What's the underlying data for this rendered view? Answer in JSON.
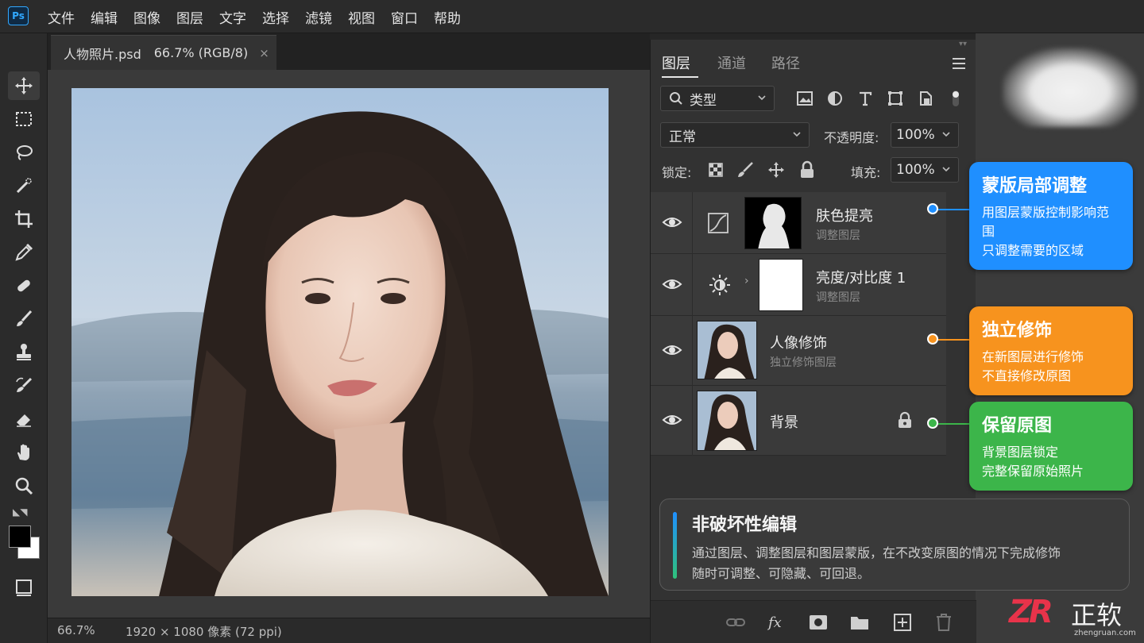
{
  "app": {
    "logo": "Ps"
  },
  "menu": [
    "文件",
    "编辑",
    "图像",
    "图层",
    "文字",
    "选择",
    "滤镜",
    "视图",
    "窗口",
    "帮助"
  ],
  "document": {
    "tab_label": "人物照片.psd",
    "tab_mode": "66.7% (RGB/8)",
    "close": "×"
  },
  "statusbar": {
    "zoom": "66.7%",
    "doc_info": "1920 × 1080 像素 (72 ppi)"
  },
  "tools": [
    "move-tool",
    "marquee-tool",
    "lasso-tool",
    "quick-select-tool",
    "crop-tool",
    "eyedropper-tool",
    "healing-brush-tool",
    "brush-tool",
    "clone-stamp-tool",
    "history-brush-tool",
    "eraser-tool",
    "hand-tool",
    "zoom-tool"
  ],
  "colors": {
    "foreground": "#000000",
    "background": "#ffffff",
    "accent_blue": "#1f8fff",
    "accent_orange": "#f7931e",
    "accent_green": "#3cb54a"
  },
  "layers_panel": {
    "tabs": [
      "图层",
      "通道",
      "路径"
    ],
    "active_tab": "图层",
    "filter": {
      "label": "类型"
    },
    "blend_mode": "正常",
    "opacity": {
      "label": "不透明度:",
      "value": "100%"
    },
    "lock": {
      "label": "锁定:"
    },
    "fill": {
      "label": "填充:",
      "value": "100%"
    },
    "layers": [
      {
        "name": "肤色提亮",
        "sub": "调整图层",
        "kind": "curves-adjustment",
        "visible": true
      },
      {
        "name": "亮度/对比度 1",
        "sub": "调整图层",
        "kind": "brightness-contrast-adjustment",
        "visible": true
      },
      {
        "name": "人像修饰",
        "sub": "独立修饰图层",
        "kind": "pixel-layer",
        "visible": true
      },
      {
        "name": "背景",
        "sub": "",
        "kind": "background-layer",
        "visible": true,
        "locked": true
      }
    ]
  },
  "callouts": [
    {
      "title": "蒙版局部调整",
      "lines": [
        "用图层蒙版控制影响范围",
        "只调整需要的区域"
      ],
      "color": "#1f8fff"
    },
    {
      "title": "独立修饰",
      "lines": [
        "在新图层进行修饰",
        "不直接修改原图"
      ],
      "color": "#f7931e"
    },
    {
      "title": "保留原图",
      "lines": [
        "背景图层锁定",
        "完整保留原始照片"
      ],
      "color": "#3cb54a"
    }
  ],
  "info_card": {
    "title": "非破坏性编辑",
    "lines": [
      "通过图层、调整图层和图层蒙版，在不改变原图的情况下完成修饰",
      "随时可调整、可隐藏、可回退。"
    ]
  },
  "watermark": {
    "logo": "ZR",
    "brand": "正软",
    "url": "zhengruan.com"
  }
}
